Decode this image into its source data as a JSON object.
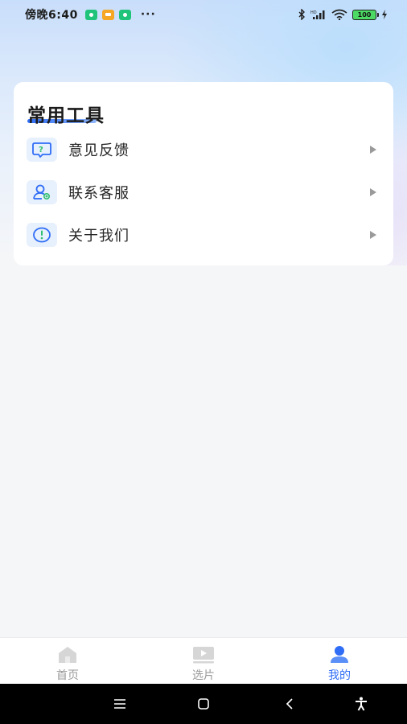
{
  "status_bar": {
    "time": "傍晚6:40",
    "more": "···",
    "battery": "100",
    "notification_colors": [
      "#20c37a",
      "#f5a623",
      "#20c37a"
    ]
  },
  "card": {
    "title": "常用工具",
    "items": [
      {
        "label": "意见反馈",
        "icon": "feedback-icon"
      },
      {
        "label": "联系客服",
        "icon": "customer-service-icon"
      },
      {
        "label": "关于我们",
        "icon": "about-icon"
      }
    ]
  },
  "bottom_nav": {
    "items": [
      {
        "label": "首页",
        "icon": "home-icon",
        "active": false
      },
      {
        "label": "选片",
        "icon": "video-icon",
        "active": false
      },
      {
        "label": "我的",
        "icon": "profile-icon",
        "active": true
      }
    ]
  },
  "colors": {
    "accent": "#2f6df6",
    "inactive": "#9a9a9a",
    "icon_green": "#2fbf6f"
  }
}
